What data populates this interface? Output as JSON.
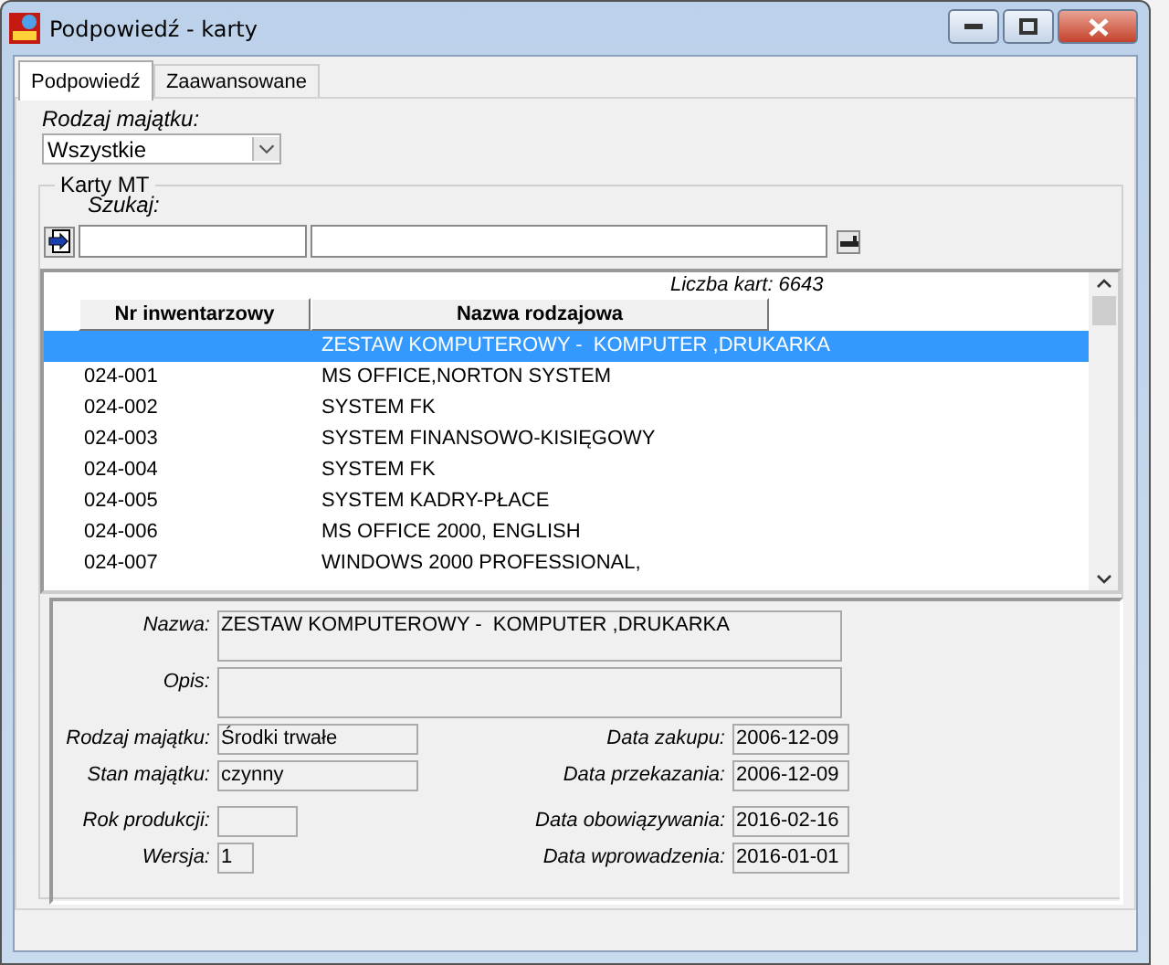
{
  "window": {
    "title": "Podpowiedź - karty"
  },
  "tabs": [
    {
      "label": "Podpowiedź",
      "selected": true
    },
    {
      "label": "Zaawansowane",
      "selected": false
    }
  ],
  "asset_type": {
    "label": "Rodzaj majątku:",
    "value": "Wszystkie"
  },
  "cards": {
    "title": "Karty MT",
    "search_label": "Szukaj:",
    "count": "Liczba kart: 6643",
    "columns": [
      "Nr inwentarzowy",
      "Nazwa rodzajowa"
    ],
    "rows": [
      {
        "name": "ZESTAW KOMPUTEROWY -  KOMPUTER ,DRUKARKA",
        "selected": true
      },
      {
        "number": "024-001",
        "name": "MS OFFICE,NORTON SYSTEM",
        "selected": false
      },
      {
        "number": "024-002",
        "name": "SYSTEM FK",
        "selected": false
      },
      {
        "number": "024-003",
        "name": "SYSTEM FINANSOWO-KISIĘGOWY",
        "selected": false
      },
      {
        "number": "024-004",
        "name": "SYSTEM FK",
        "selected": false
      },
      {
        "number": "024-005",
        "name": "SYSTEM KADRY-PŁACE",
        "selected": false
      },
      {
        "number": "024-006",
        "name": "MS OFFICE 2000, ENGLISH",
        "selected": false
      },
      {
        "number": "024-007",
        "name": "WINDOWS 2000 PROFESSIONAL,",
        "selected": false
      }
    ]
  },
  "details": {
    "name": {
      "label": "Nazwa:",
      "value": "ZESTAW KOMPUTEROWY -  KOMPUTER ,DRUKARKA"
    },
    "description": {
      "label": "Opis:"
    },
    "left": [
      {
        "label": "Rodzaj majątku:",
        "value": "Środki trwałe",
        "kind": "wide"
      },
      {
        "label": "Stan majątku:",
        "value": "czynny",
        "kind": "wide"
      },
      {
        "label": "Rok produkcji:",
        "kind": "medium"
      },
      {
        "label": "Wersja:",
        "value": "1",
        "kind": "small"
      }
    ],
    "right": [
      {
        "label": "Data zakupu:",
        "value": "2006-12-09"
      },
      {
        "label": "Data przekazania:",
        "value": "2006-12-09"
      },
      {
        "label": "Data obowiązywania:",
        "value": "2016-02-16"
      },
      {
        "label": "Data wprowadzenia:",
        "value": "2016-01-01"
      }
    ]
  }
}
